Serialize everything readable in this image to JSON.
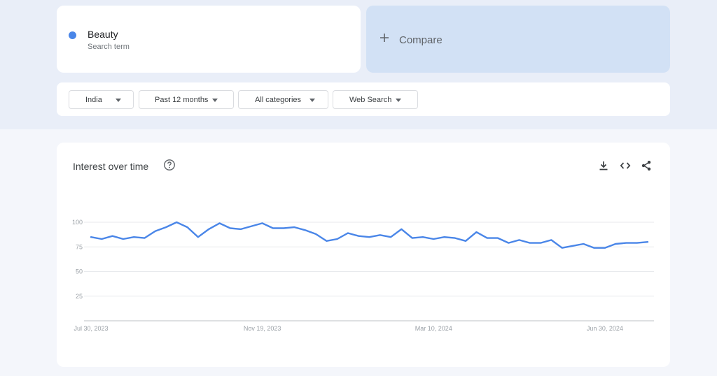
{
  "search_term": {
    "name": "Beauty",
    "subtitle": "Search term",
    "color": "#4a86e8"
  },
  "compare": {
    "label": "Compare",
    "icon": "plus-icon"
  },
  "filters": [
    {
      "label": "India",
      "icon": "caret-down-icon"
    },
    {
      "label": "Past 12 months",
      "icon": "caret-down-icon"
    },
    {
      "label": "All categories",
      "icon": "caret-down-icon"
    },
    {
      "label": "Web Search",
      "icon": "caret-down-icon"
    }
  ],
  "panel": {
    "title": "Interest over time",
    "icons": [
      "help-icon",
      "download-icon",
      "embed-code-icon",
      "share-icon"
    ]
  },
  "chart_data": {
    "type": "line",
    "title": "",
    "xlabel": "",
    "ylabel": "",
    "ylim": [
      0,
      100
    ],
    "yticks": [
      25,
      50,
      75,
      100
    ],
    "grid": true,
    "line_color": "#4a86e8",
    "x_tick_labels": [
      "Jul 30, 2023",
      "Nov 19, 2023",
      "Mar 10, 2024",
      "Jun 30, 2024"
    ],
    "x_start": "2023-07-30",
    "x_step_days": 7,
    "series": [
      {
        "name": "Beauty",
        "values": [
          85,
          83,
          86,
          83,
          85,
          84,
          91,
          95,
          100,
          95,
          85,
          93,
          99,
          94,
          93,
          96,
          99,
          94,
          94,
          95,
          92,
          88,
          81,
          83,
          89,
          86,
          85,
          87,
          85,
          93,
          84,
          85,
          83,
          85,
          84,
          81,
          90,
          84,
          84,
          79,
          82,
          79,
          79,
          82,
          74,
          76,
          78,
          74,
          74,
          78,
          79,
          79,
          80
        ]
      }
    ]
  }
}
